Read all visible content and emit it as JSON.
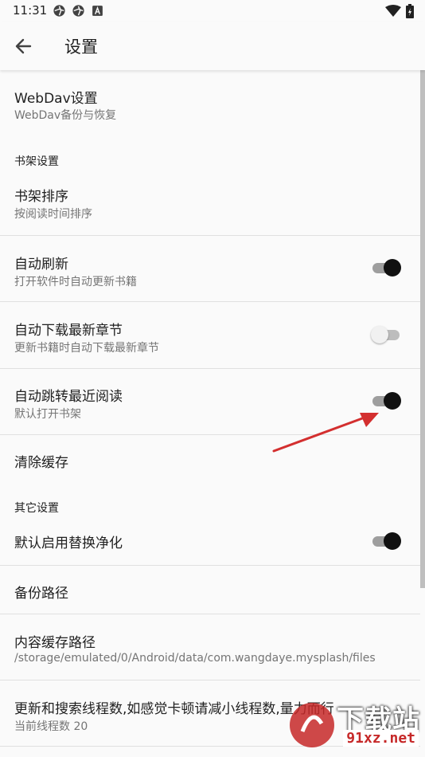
{
  "status_bar": {
    "time": "11:31",
    "icons_left": [
      "aperture-icon",
      "aperture-icon",
      "a-square-icon"
    ],
    "icons_right": [
      "wifi-icon",
      "battery-charging-icon"
    ]
  },
  "app_bar": {
    "title": "设置",
    "back_icon": "arrow-left-icon"
  },
  "settings": {
    "webdav": {
      "title": "WebDav设置",
      "summary": "WebDav备份与恢复"
    },
    "bookshelf_category": "书架设置",
    "shelf_sort": {
      "title": "书架排序",
      "summary": "按阅读时间排序"
    },
    "auto_refresh": {
      "title": "自动刷新",
      "summary": "打开软件时自动更新书籍",
      "enabled": true
    },
    "auto_download": {
      "title": "自动下载最新章节",
      "summary": "更新书籍时自动下载最新章节",
      "enabled": false
    },
    "auto_jump": {
      "title": "自动跳转最近阅读",
      "summary": "默认打开书架",
      "enabled": true
    },
    "clear_cache": {
      "title": "清除缓存"
    },
    "other_category": "其它设置",
    "replace_purify": {
      "title": "默认启用替换净化",
      "enabled": true
    },
    "backup_path": {
      "title": "备份路径"
    },
    "cache_path": {
      "title": "内容缓存路径",
      "summary": "/storage/emulated/0/Android/data/com.wangdaye.mysplash/files"
    },
    "threads": {
      "title": "更新和搜索线程数,如感觉卡顿请减小线程数,量力而行",
      "summary": "当前线程数 20"
    }
  },
  "colors": {
    "switch_on_thumb": "#111111",
    "switch_on_track": "#9e9e9e",
    "annotation_arrow": "#d32f2f"
  },
  "watermark": {
    "text": "下载站",
    "url": "91xz.net"
  }
}
